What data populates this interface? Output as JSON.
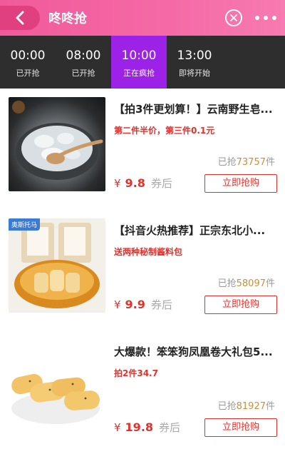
{
  "header": {
    "title": "咚咚抢"
  },
  "tabs": [
    {
      "time": "00:00",
      "status": "已开抢"
    },
    {
      "time": "08:00",
      "status": "已开抢"
    },
    {
      "time": "10:00",
      "status": "正在疯抢"
    },
    {
      "time": "13:00",
      "status": "即将开始"
    }
  ],
  "items": [
    {
      "name": "【拍3件更划算！】云南野生皂...",
      "promo": "第二件半价，第三件0.1元",
      "sold_label": "已抢",
      "sold_count": "73757",
      "sold_unit": "件",
      "currency": "¥",
      "price": "9.8",
      "price_suffix": "券后",
      "buy_label": "立即抢购"
    },
    {
      "badge": "奥斯托马",
      "name": "【抖音火热推荐】正宗东北小...",
      "promo": "送两种秘制酱料包",
      "sold_label": "已抢",
      "sold_count": "58097",
      "sold_unit": "件",
      "currency": "¥",
      "price": "9.9",
      "price_suffix": "券后",
      "buy_label": "立即抢购"
    },
    {
      "name": "大爆款！笨笨狗凤凰卷大礼包5...",
      "promo": "拍2件34.7",
      "sold_label": "已抢",
      "sold_count": "81927",
      "sold_unit": "件",
      "currency": "¥",
      "price": "19.8",
      "price_suffix": "券后",
      "buy_label": "立即抢购"
    }
  ],
  "colors": {
    "header": "#f15a9a",
    "tab_active": "#9b22e6",
    "tabbar": "#2e2e2e",
    "price_red": "#e0322e",
    "sold_gold": "#c8903c"
  }
}
